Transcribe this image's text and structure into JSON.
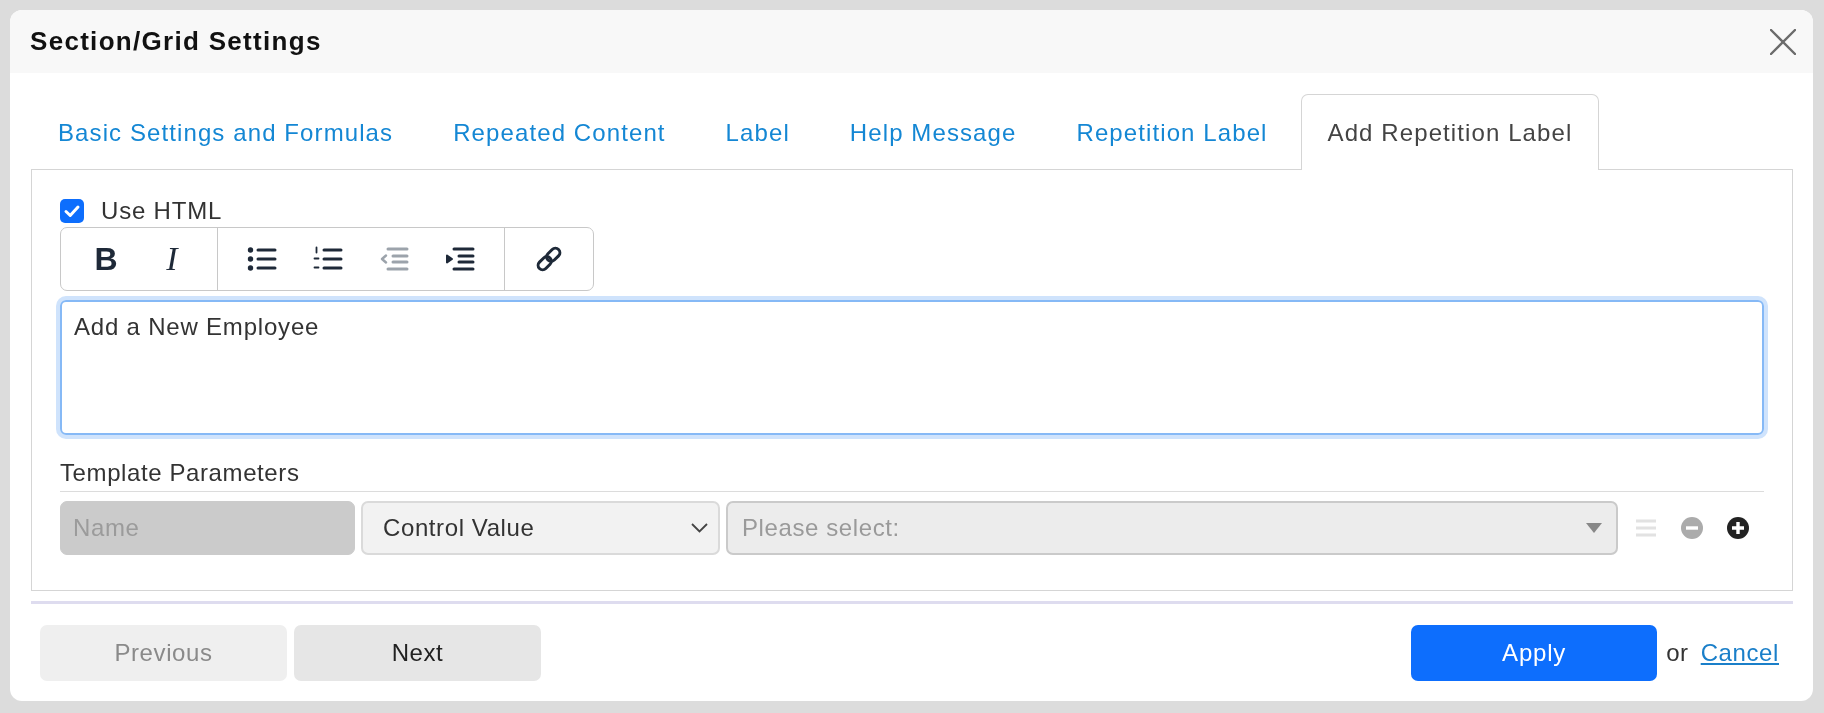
{
  "window": {
    "title": "Section/Grid Settings"
  },
  "tabs": [
    {
      "label": "Basic Settings and Formulas",
      "selected": false
    },
    {
      "label": "Repeated Content",
      "selected": false
    },
    {
      "label": "Label",
      "selected": false
    },
    {
      "label": "Help Message",
      "selected": false
    },
    {
      "label": "Repetition Label",
      "selected": false
    },
    {
      "label": "Add Repetition Label",
      "selected": true
    }
  ],
  "use_html": {
    "label": "Use HTML",
    "checked": true
  },
  "toolbar": {
    "groups": [
      {
        "buttons": [
          {
            "kind": "bold",
            "label": "B",
            "disabled": false
          },
          {
            "kind": "italic",
            "label": "I",
            "disabled": false
          }
        ]
      },
      {
        "buttons": [
          {
            "kind": "bullet-list",
            "disabled": false
          },
          {
            "kind": "numbered-list",
            "disabled": false
          },
          {
            "kind": "outdent",
            "disabled": true
          },
          {
            "kind": "indent",
            "disabled": false
          }
        ]
      },
      {
        "buttons": [
          {
            "kind": "link",
            "disabled": false
          }
        ]
      }
    ]
  },
  "editor": {
    "value": "Add a New Employee"
  },
  "template_parameters": {
    "heading": "Template Parameters",
    "rows": [
      {
        "name": {
          "placeholder": "Name",
          "disabled": true
        },
        "source": {
          "value": "Control Value"
        },
        "control": {
          "placeholder": "Please select:",
          "disabled": true
        },
        "actions": [
          {
            "kind": "drag",
            "disabled": true
          },
          {
            "kind": "remove",
            "disabled": true
          },
          {
            "kind": "add",
            "disabled": false
          }
        ]
      }
    ]
  },
  "footer": {
    "nav_buttons": [
      {
        "label": "Previous",
        "disabled": true
      },
      {
        "label": "Next",
        "disabled": false
      }
    ],
    "apply": {
      "label": "Apply"
    },
    "separator": "or",
    "cancel": {
      "label": "Cancel"
    }
  }
}
